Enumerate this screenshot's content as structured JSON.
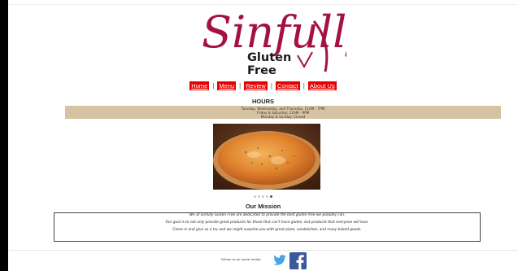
{
  "brand": {
    "script_name": "Sinfully",
    "sub_name": "Gluten Free",
    "colors": {
      "script": "#a4123f",
      "sub": "#1a1a1a"
    }
  },
  "nav": {
    "items": [
      {
        "label": "Home"
      },
      {
        "label": "Menu"
      },
      {
        "label": "Review"
      },
      {
        "label": "Contact"
      },
      {
        "label": "About Us"
      }
    ],
    "separator": "|",
    "button_color": "#e60000"
  },
  "hours": {
    "title": "HOURS",
    "lines": [
      "Tuesday, Wednesday, and Thursday: 11AM - 7PM",
      "Friday & Saturday: 11AM - 9PM",
      "Monday & Sunday: Closed"
    ],
    "box_color": "#d6c3a3"
  },
  "slideshow": {
    "image_icon": "pizza-photo",
    "slide_count": 5,
    "active_index": 4
  },
  "mission": {
    "title": "Our Mission",
    "lines": [
      "We at Sinfully Gluten Free are dedicated to provide the best gluten free we possibly can.",
      "Our goal is to not only provide great products for those that can't have gluten, but products that everyone will love.",
      "Come in and give us a try and we might surprise you with great pizza, sandwiches, and many baked goods."
    ]
  },
  "footer": {
    "social_label": "Follow us on social media",
    "icons": [
      "twitter-icon",
      "facebook-icon"
    ],
    "colors": {
      "twitter": "#4aa3e6",
      "facebook": "#3b5998"
    }
  }
}
